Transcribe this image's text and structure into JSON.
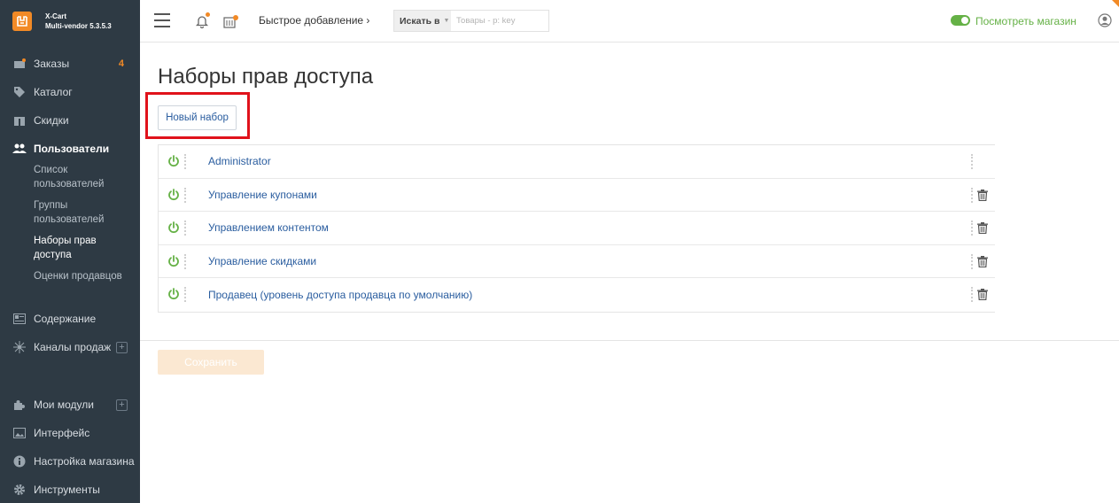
{
  "brand": {
    "name": "X-Cart",
    "edition": "Multi-vendor 5.3.5.3"
  },
  "sidebar": {
    "items": [
      {
        "label": "Заказы",
        "badge": "4"
      },
      {
        "label": "Каталог"
      },
      {
        "label": "Скидки"
      },
      {
        "label": "Пользователи"
      },
      {
        "label": "Содержание"
      },
      {
        "label": "Каналы продаж"
      },
      {
        "label": "Мои модули"
      },
      {
        "label": "Интерфейс"
      },
      {
        "label": "Настройка магазина"
      },
      {
        "label": "Инструменты"
      }
    ],
    "subitems": [
      {
        "label": "Список пользователей"
      },
      {
        "label": "Группы пользователей"
      },
      {
        "label": "Наборы прав доступа"
      },
      {
        "label": "Оценки продавцов"
      }
    ]
  },
  "header": {
    "quick_add": "Быстрое добавление",
    "search_scope": "Искать в",
    "search_placeholder": "Товары - p: key",
    "view_store": "Посмотреть магазин"
  },
  "main": {
    "title": "Наборы прав доступа",
    "new_button": "Новый набор",
    "roles": [
      {
        "name": "Administrator",
        "deletable": false
      },
      {
        "name": "Управление купонами",
        "deletable": true
      },
      {
        "name": "Управлением контентом",
        "deletable": true
      },
      {
        "name": "Управление скидками",
        "deletable": true
      },
      {
        "name": "Продавец (уровень доступа продавца по умолчанию)",
        "deletable": true
      }
    ],
    "save_button": "Сохранить"
  },
  "colors": {
    "accent": "#f28a26",
    "link": "#2a5d9f",
    "active_green": "#65b146",
    "highlight": "#e0121b"
  }
}
